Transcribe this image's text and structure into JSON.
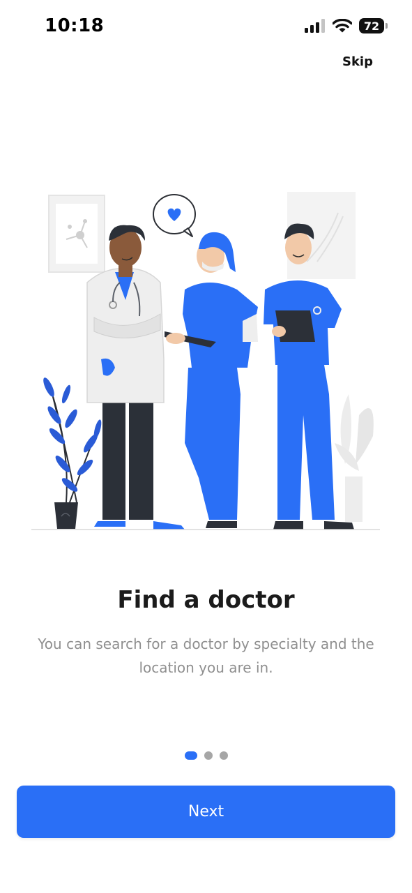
{
  "status_bar": {
    "time": "10:18",
    "battery": "72",
    "icons": [
      "cellular-signal-icon",
      "wifi-icon",
      "battery-icon"
    ]
  },
  "header": {
    "skip_label": "Skip"
  },
  "onboarding": {
    "title": "Find a doctor",
    "description": "You can search for a doctor by specialty and the location you are in.",
    "pager": {
      "total": 3,
      "active_index": 0
    }
  },
  "footer": {
    "next_label": "Next"
  },
  "colors": {
    "accent": "#2a6ff6",
    "scrubs": "#2d6bf0",
    "text_primary": "#1b1b1b",
    "text_secondary": "#8f8f8f",
    "dot_inactive": "#a6a6a6"
  }
}
